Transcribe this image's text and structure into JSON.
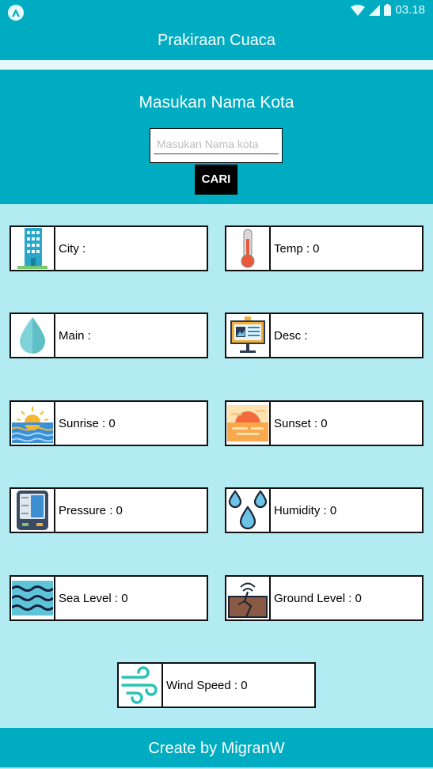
{
  "status_bar": {
    "time": "03.18"
  },
  "app_bar": {
    "title": "Prakiraan Cuaca"
  },
  "header": {
    "title": "Masukan Nama Kota",
    "search_placeholder": "Masukan Nama kota",
    "search_value": "",
    "button_label": "CARI"
  },
  "cards": {
    "city": "City :",
    "temp": "Temp : 0",
    "main": "Main :",
    "desc": "Desc :",
    "sunrise": "Sunrise : 0",
    "sunset": "Sunset : 0",
    "pressure": "Pressure : 0",
    "humidity": "Humidity : 0",
    "sea_level": "Sea Level : 0",
    "ground_level": "Ground Level : 0",
    "wind_speed": "Wind Speed : 0"
  },
  "footer": {
    "text": "Create by MigranW"
  },
  "colors": {
    "primary": "#00acc1",
    "background": "#b3ebf2",
    "button": "#000000"
  }
}
